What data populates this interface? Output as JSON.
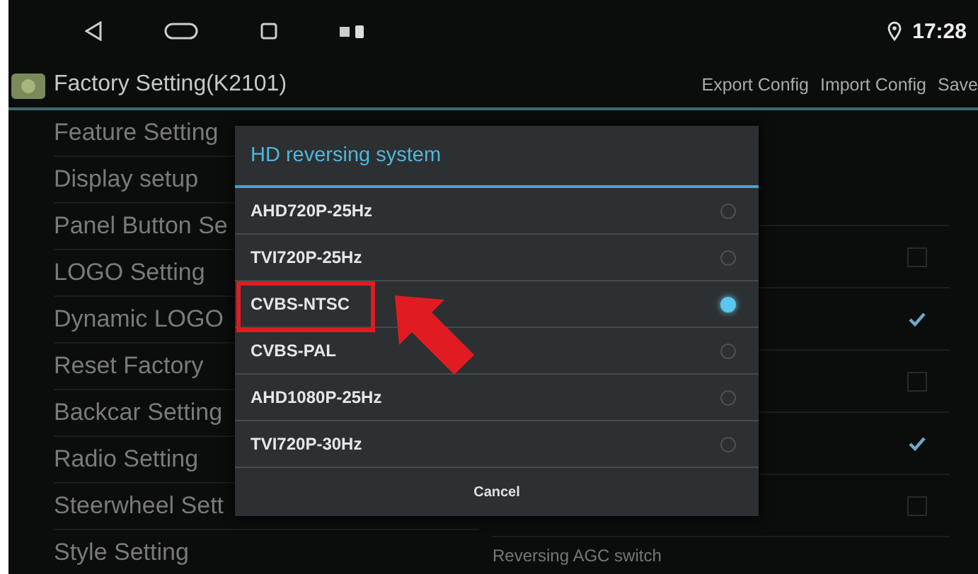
{
  "status_bar": {
    "time": "17:28"
  },
  "title_bar": {
    "title": "Factory Setting(K2101)",
    "actions": [
      "Export Config",
      "Import Config",
      "Save"
    ]
  },
  "sidebar": {
    "items": [
      {
        "label": "Feature Setting"
      },
      {
        "label": "Display setup"
      },
      {
        "label": "Panel Button Se"
      },
      {
        "label": "LOGO Setting"
      },
      {
        "label": "Dynamic LOGO"
      },
      {
        "label": "Reset Factory"
      },
      {
        "label": "Backcar Setting"
      },
      {
        "label": "Radio Setting"
      },
      {
        "label": "Steerwheel Sett"
      },
      {
        "label": "Style Setting"
      }
    ]
  },
  "settings": {
    "rows": [
      {
        "checked": false
      },
      {
        "checked": true
      },
      {
        "checked": false
      },
      {
        "checked": true
      },
      {
        "checked": false
      }
    ],
    "bottom_label": "Reversing AGC switch"
  },
  "dialog": {
    "title": "HD reversing system",
    "options": [
      {
        "label": "AHD720P-25Hz",
        "selected": false
      },
      {
        "label": "TVI720P-25Hz",
        "selected": false
      },
      {
        "label": "CVBS-NTSC",
        "selected": true
      },
      {
        "label": "CVBS-PAL",
        "selected": false
      },
      {
        "label": "AHD1080P-25Hz",
        "selected": false
      },
      {
        "label": "TVI720P-30Hz",
        "selected": false
      }
    ],
    "cancel": "Cancel"
  }
}
